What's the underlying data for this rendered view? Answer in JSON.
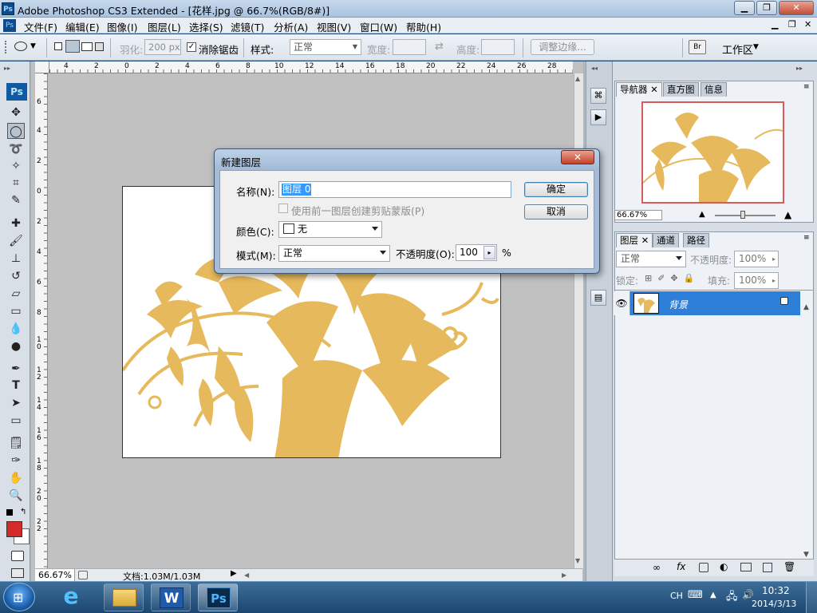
{
  "title": "Adobe Photoshop CS3 Extended - [花样.jpg @ 66.7%(RGB/8#)]",
  "menu": [
    "文件(F)",
    "编辑(E)",
    "图像(I)",
    "图层(L)",
    "选择(S)",
    "滤镜(T)",
    "分析(A)",
    "视图(V)",
    "窗口(W)",
    "帮助(H)"
  ],
  "options": {
    "feather_label": "羽化:",
    "feather_value": "200 px",
    "antialias_label": "消除锯齿",
    "style_label": "样式:",
    "style_value": "正常",
    "width_label": "宽度:",
    "height_label": "高度:",
    "refine_edge": "调整边缘...",
    "workspace": "工作区"
  },
  "ruler_top": [
    "4",
    "2",
    "0",
    "2",
    "4",
    "6",
    "8",
    "10",
    "12",
    "14",
    "16",
    "18",
    "20",
    "22",
    "24",
    "26",
    "28"
  ],
  "ruler_left": [
    "6",
    "4",
    "2",
    "0",
    "2",
    "4",
    "6",
    "8",
    "1\n0",
    "1\n2",
    "1\n4",
    "1\n6",
    "1\n8",
    "2\n0",
    "2\n2"
  ],
  "status": {
    "zoom": "66.67%",
    "doc": "文档:1.03M/1.03M"
  },
  "navigator": {
    "tabs": [
      "导航器",
      "直方图",
      "信息"
    ],
    "zoom": "66.67%"
  },
  "layers": {
    "tabs": [
      "图层",
      "通道",
      "路径"
    ],
    "blend_mode": "正常",
    "opacity_label": "不透明度:",
    "opacity_value": "100%",
    "lock_label": "锁定:",
    "fill_label": "填充:",
    "fill_value": "100%",
    "layer_name": "背景"
  },
  "dialog": {
    "title": "新建图层",
    "name_label": "名称(N):",
    "name_value": "图层 0",
    "clip_label": "使用前一图层创建剪贴蒙版(P)",
    "color_label": "颜色(C):",
    "color_value": "无",
    "mode_label": "模式(M):",
    "mode_value": "正常",
    "opacity_label": "不透明度(O):",
    "opacity_value": "100",
    "percent": "%",
    "ok": "确定",
    "cancel": "取消"
  },
  "taskbar": {
    "lang": "CH",
    "time": "10:32",
    "date": "2014/3/13"
  },
  "colors": {
    "foreground": "#d42a2a",
    "selected_layer": "#2e7fd8",
    "flower": "#e6b95c"
  }
}
